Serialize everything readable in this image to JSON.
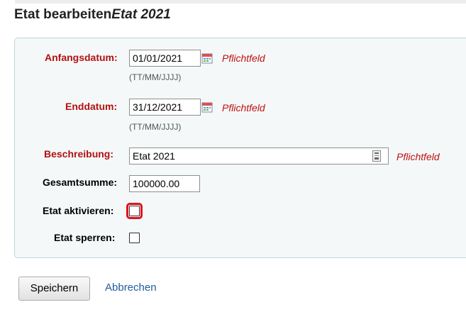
{
  "header": {
    "title_prefix": "Etat bearbeiten",
    "title_name": "Etat 2021"
  },
  "form": {
    "start_date": {
      "label": "Anfangsdatum:",
      "value": "01/01/2021",
      "hint": "(TT/MM/JJJJ)",
      "required_text": "Pflichtfeld",
      "icon": "calendar-icon"
    },
    "end_date": {
      "label": "Enddatum:",
      "value": "31/12/2021",
      "hint": "(TT/MM/JJJJ)",
      "required_text": "Pflichtfeld",
      "icon": "calendar-icon"
    },
    "description": {
      "label": "Beschreibung:",
      "value": "Etat 2021",
      "required_text": "Pflichtfeld",
      "icon": "expand-textarea-icon"
    },
    "total": {
      "label": "Gesamtsumme:",
      "value": "100000.00"
    },
    "activate": {
      "label": "Etat aktivieren:",
      "checked": false
    },
    "lock": {
      "label": "Etat sperren:",
      "checked": false
    }
  },
  "actions": {
    "save_label": "Speichern",
    "cancel_label": "Abbrechen"
  },
  "colors": {
    "required_label": "#b31010",
    "panel_background": "#f4f8f9",
    "panel_border": "#bfd6dc",
    "link": "#1f5e9d",
    "focus_outline": "#e1101a"
  }
}
